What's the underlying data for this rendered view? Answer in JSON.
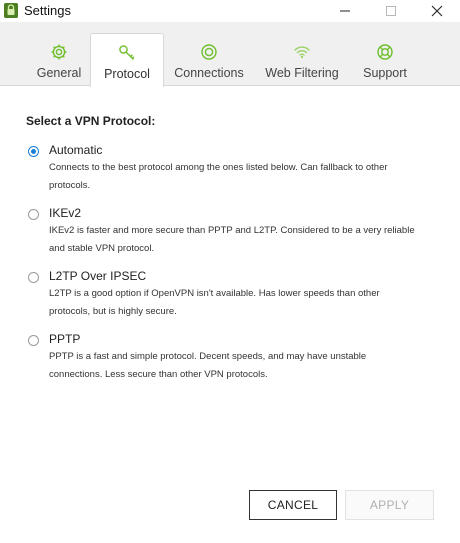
{
  "window": {
    "title": "Settings",
    "controls": [
      "minimize",
      "maximize",
      "close"
    ]
  },
  "tabs": [
    {
      "label": "General",
      "icon": "gear-icon",
      "active": false
    },
    {
      "label": "Protocol",
      "icon": "key-icon",
      "active": true
    },
    {
      "label": "Connections",
      "icon": "power-icon",
      "active": false
    },
    {
      "label": "Web Filtering",
      "icon": "wifi-icon",
      "active": false
    },
    {
      "label": "Support",
      "icon": "lifebuoy-icon",
      "active": false
    }
  ],
  "protocol": {
    "section_title": "Select a VPN Protocol:",
    "selected": "Automatic",
    "options": [
      {
        "label": "Automatic",
        "description": "Connects to the best protocol among the ones listed below. Can fallback to other protocols."
      },
      {
        "label": "IKEv2",
        "description": "IKEv2 is faster and more secure than PPTP and L2TP. Considered to be a very reliable and stable VPN protocol."
      },
      {
        "label": "L2TP Over IPSEC",
        "description": "L2TP is a good option if OpenVPN isn't available. Has lower speeds than other protocols, but is highly secure."
      },
      {
        "label": "PPTP",
        "description": "PPTP is a fast and simple protocol. Decent speeds, and may have unstable connections. Less secure than other VPN protocols."
      }
    ]
  },
  "buttons": {
    "cancel": "CANCEL",
    "apply": "APPLY"
  },
  "colors": {
    "accent_green": "#6fbf2c",
    "radio_selected": "#1a7fd9",
    "tab_bar_bg": "#f0f0f0"
  }
}
